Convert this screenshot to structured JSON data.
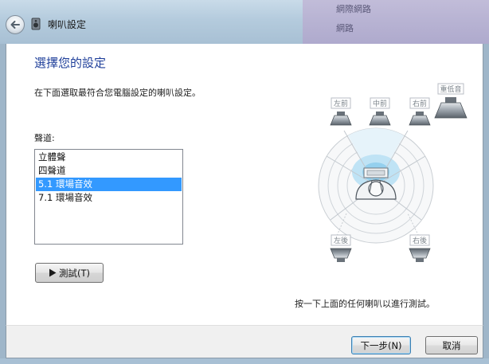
{
  "window": {
    "title": "喇叭設定"
  },
  "backdrop": {
    "text_1": "網際網路",
    "text_2": "網路"
  },
  "page": {
    "heading": "選擇您的設定",
    "instruction": "在下面選取最符合您電腦設定的喇叭設定。",
    "channels_label": "聲道:",
    "channels": [
      "立體聲",
      "四聲道",
      "5.1 環場音效",
      "7.1 環場音效"
    ],
    "selected_channel": "5.1 環場音效",
    "test_button_label": "測試(T)",
    "hint": "按一下上面的任何喇叭以進行測試。"
  },
  "speakers": {
    "front_left": "左前",
    "center": "中前",
    "front_right": "右前",
    "subwoofer": "重低音",
    "rear_left": "左後",
    "rear_right": "右後"
  },
  "footer": {
    "next_label": "下一步(N)",
    "cancel_label": "取消"
  },
  "colors": {
    "heading": "#1f3f9a",
    "selection": "#3399ff",
    "sound_field": "#bfe3f5"
  },
  "icons": {
    "back": "back-arrow-icon",
    "window": "speaker-window-icon",
    "play": "play-triangle-icon"
  }
}
